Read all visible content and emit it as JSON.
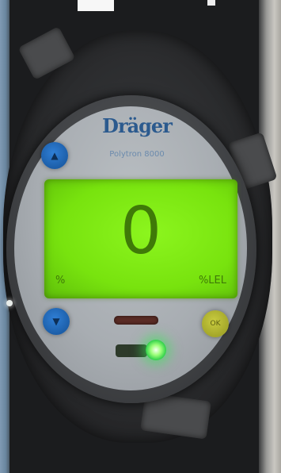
{
  "device": {
    "brand": "Dräger",
    "model": "Polytron 8000",
    "display": {
      "value": "0",
      "unit": "%",
      "gas": "%LEL"
    },
    "buttons": {
      "top_left_glyph": "▲",
      "bottom_left_glyph": "▼",
      "right_glyph": "OK"
    },
    "indicators": {
      "fault_led_color": "#5a2c25",
      "status_led_color": "#2fd04a",
      "status_led_lit": true
    },
    "lcd_color": "#78e30e"
  }
}
